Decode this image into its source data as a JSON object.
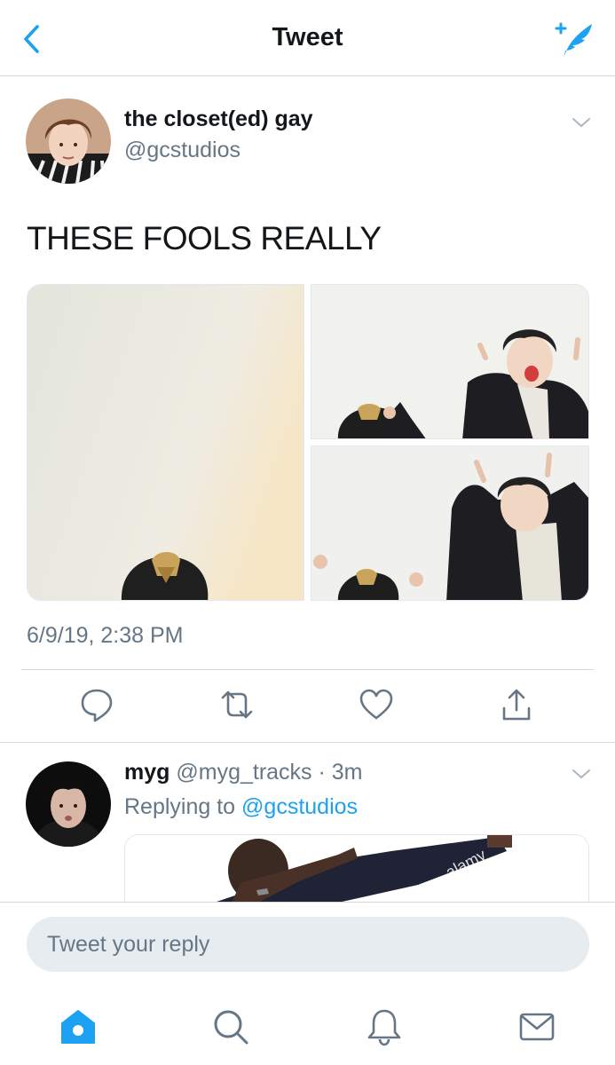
{
  "header": {
    "title": "Tweet",
    "back_icon": "chevron-left-icon",
    "compose_icon": "compose-tweet-icon"
  },
  "tweet": {
    "author_name": "the closet(ed) gay",
    "author_handle": "@gcstudios",
    "text": "THESE FOOLS REALLY",
    "timestamp": "6/9/19, 2:38 PM",
    "media_count": 3
  },
  "actions": [
    "reply-icon",
    "retweet-icon",
    "like-icon",
    "share-icon"
  ],
  "reply": {
    "name": "myg",
    "handle_time": "@myg_tracks · 3m",
    "replying_prefix": "Replying to ",
    "replying_to": "@gcstudios",
    "watermark": "alamy"
  },
  "composer": {
    "placeholder": "Tweet your reply"
  },
  "tabbar": [
    "home-icon",
    "search-icon",
    "notifications-icon",
    "messages-icon"
  ],
  "colors": {
    "accent": "#1da1f2",
    "secondary_text": "#657786",
    "divider": "#d7d7d7",
    "reply_box": "#e6ecf0"
  }
}
